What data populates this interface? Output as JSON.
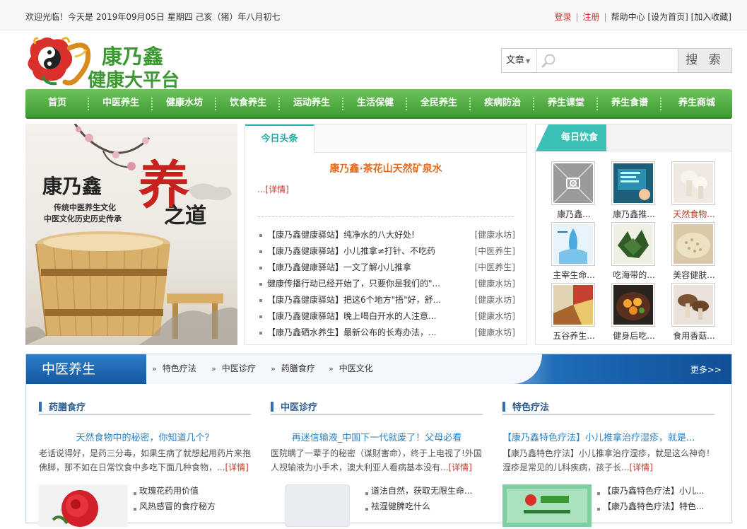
{
  "topbar": {
    "greeting": "欢迎光临！今天是 2019年09月05日 星期四 己亥（猪）年八月初七",
    "login": "登录",
    "register": "注册",
    "help": "帮助中心",
    "set_home": "[设为首页]",
    "bookmark": "[加入收藏]"
  },
  "logo": {
    "line1": "康乃鑫",
    "line2": "健康大平台"
  },
  "search": {
    "category": "文章",
    "placeholder": "",
    "button": "搜 索"
  },
  "nav": [
    "首页",
    "中医养生",
    "健康水坊",
    "饮食养生",
    "运动养生",
    "生活保健",
    "全民养生",
    "疾病防治",
    "养生课堂",
    "养生食谱",
    "养生商城"
  ],
  "banner": {
    "brand": "康乃鑫",
    "big_char": "养",
    "sub_char": "之道",
    "line1": "传统中医养生文化",
    "line2": "中医文化历史历史传承"
  },
  "headlines": {
    "tab": "今日头条",
    "title": "康乃鑫·茶花山天然矿泉水",
    "detail": "...[详情]",
    "items": [
      {
        "text": "【康乃鑫健康驿站】纯净水的八大好处!",
        "cat": "[健康水坊]"
      },
      {
        "text": "【康乃鑫健康驿站】小儿推拿≠打针、不吃药",
        "cat": "[中医养生]"
      },
      {
        "text": "【康乃鑫健康驿站】一文了解小儿推拿",
        "cat": "[中医养生]"
      },
      {
        "text": "健康传播行动已经开始了，只要你是我们的\"...",
        "cat": "[健康水坊]"
      },
      {
        "text": "【康乃鑫健康驿站】把这6个地方\"捂\"好，舒...",
        "cat": "[健康水坊]"
      },
      {
        "text": "【康乃鑫健康驿站】晚上喝白开水的人注意...",
        "cat": "[健康水坊]"
      },
      {
        "text": "【康乃鑫硒水养生】最新公布的长寿办法，...",
        "cat": "[健康水坊]"
      }
    ]
  },
  "daily": {
    "title": "每日饮食",
    "items": [
      {
        "caption": "康乃鑫...",
        "icon": "placeholder-image-icon",
        "red": false
      },
      {
        "caption": "康乃鑫推...",
        "icon": "screen-thumb",
        "red": false
      },
      {
        "caption": "天然食物...",
        "icon": "mushroom-thumb",
        "red": true
      },
      {
        "caption": "主宰生命...",
        "icon": "water-thumb",
        "red": false
      },
      {
        "caption": "吃海带的...",
        "icon": "kelp-thumb",
        "red": false
      },
      {
        "caption": "美容健肤...",
        "icon": "grain-thumb",
        "red": false
      },
      {
        "caption": "五谷养生...",
        "icon": "grains-thumb",
        "red": false
      },
      {
        "caption": "健身后吃...",
        "icon": "dish-thumb",
        "red": false
      },
      {
        "caption": "食用香菇...",
        "icon": "shiitake-thumb",
        "red": false
      }
    ]
  },
  "tcm": {
    "title": "中医养生",
    "subs": [
      "特色疗法",
      "中医诊疗",
      "药膳食疗",
      "中医文化"
    ],
    "more": "更多>>",
    "columns": [
      {
        "name": "药膳食疗",
        "title": "天然食物中的秘密，你知道几个？",
        "desc": "老话说得好，是药三分毒，如果生病了就想起用药片来抱佛脚，那不如在日常饮食中多吃下面几种食物，...",
        "detail": "[详情]",
        "mini": [
          "玫瑰花药用价值",
          "风热感冒的食疗秘方"
        ]
      },
      {
        "name": "中医诊疗",
        "title": "再迷信输液_中国下一代就废了！父母必看",
        "desc": "医院瞒了一辈子的秘密（谋财害命），终于上电视了!外国人视输液为小手术，澳大利亚人看病基本没有...",
        "detail": "[详情]",
        "mini": [
          "道法自然，获取无限生命...",
          "祛湿健脾吃什么"
        ]
      },
      {
        "name": "特色疗法",
        "title": "【康乃鑫特色疗法】小儿推拿治疗湿疹，就是...",
        "desc": "【康乃鑫特色疗法】小儿推拿治疗湿疹，就是这么神奇！ 湿疹是常见的儿科疾病，孩子长...",
        "detail": "[详情]",
        "mini": [
          "【康乃鑫特色疗法】小儿...",
          "【康乃鑫特色疗法】特色..."
        ]
      }
    ]
  },
  "colors": {
    "nav_green": "#4fae41",
    "teal": "#27b5b0",
    "orange_title": "#e16d23",
    "link_red": "#c0392b",
    "section_blue": "#1f6cb8"
  }
}
